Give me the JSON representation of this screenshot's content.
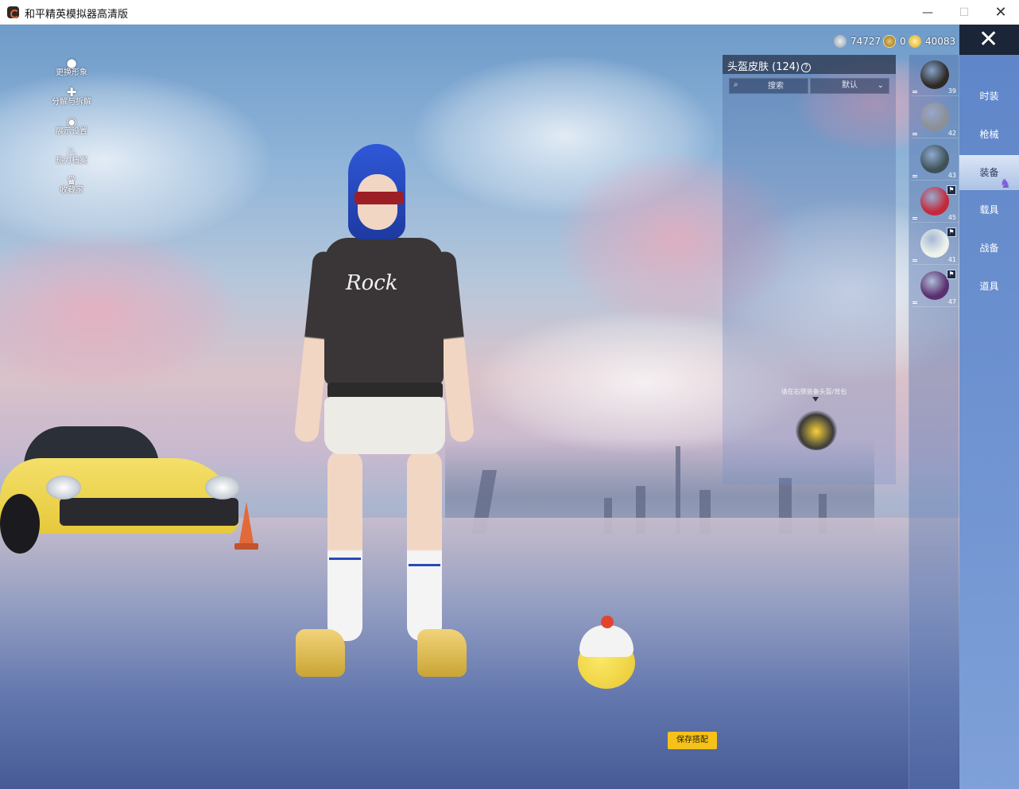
{
  "window": {
    "title": "和平精英模拟器高清版",
    "min_glyph": "—",
    "max_glyph": "☐",
    "close_glyph": "✕"
  },
  "left_menu": [
    {
      "label": "更换形象",
      "icon": "person-icon",
      "glyph": "●"
    },
    {
      "label": "分解与拆解",
      "icon": "puzzle-icon",
      "glyph": "✚"
    },
    {
      "label": "展示设置",
      "icon": "eye-icon",
      "glyph": "◉"
    },
    {
      "label": "热力档案",
      "icon": "flame-icon",
      "glyph": "♨"
    },
    {
      "label": "收藏家",
      "icon": "crest-icon",
      "glyph": "♛"
    }
  ],
  "currency": [
    {
      "value": "74727",
      "icon": "silver-coin-icon"
    },
    {
      "value": "0",
      "icon": "token-coin-icon"
    },
    {
      "value": "40083",
      "icon": "gold-coin-icon"
    }
  ],
  "character": {
    "shirt_text": "Rock"
  },
  "panel": {
    "title": "头盔皮肤 (124)",
    "info_glyph": "?",
    "search_glyph": "⌕",
    "search_placeholder": "搜索",
    "sort_value": "默认",
    "sort_glyph": "⌄",
    "hint": "请在右侧装备头盔/背包"
  },
  "items": [
    {
      "level": "39",
      "icon": "helmet-level3-icon",
      "color": "#2d2a26",
      "badge": ""
    },
    {
      "level": "42",
      "icon": "helmet-level2-icon",
      "color": "#8c9096",
      "badge": ""
    },
    {
      "level": "43",
      "icon": "helmet-level1-icon",
      "color": "#3f5158",
      "badge": ""
    },
    {
      "level": "45",
      "icon": "backpack-red-icon",
      "color": "#c4283a",
      "badge": "⚑"
    },
    {
      "level": "41",
      "icon": "backpack-bunny-icon",
      "color": "#eef2ea",
      "badge": "⚑"
    },
    {
      "level": "47",
      "icon": "backpack-purple-icon",
      "color": "#5a2f6e",
      "badge": "⚑"
    }
  ],
  "categories": [
    {
      "label": "时装",
      "active": false
    },
    {
      "label": "枪械",
      "active": false
    },
    {
      "label": "装备",
      "active": true
    },
    {
      "label": "载具",
      "active": false
    },
    {
      "label": "战备",
      "active": false
    },
    {
      "label": "道具",
      "active": false
    }
  ],
  "close_glyph": "✕",
  "dragon_glyph": "♞",
  "save_label": "保存搭配",
  "colors": {
    "accent": "#f5c21a",
    "tab_bg": "#6f93d0",
    "panel_header": "#283246"
  }
}
